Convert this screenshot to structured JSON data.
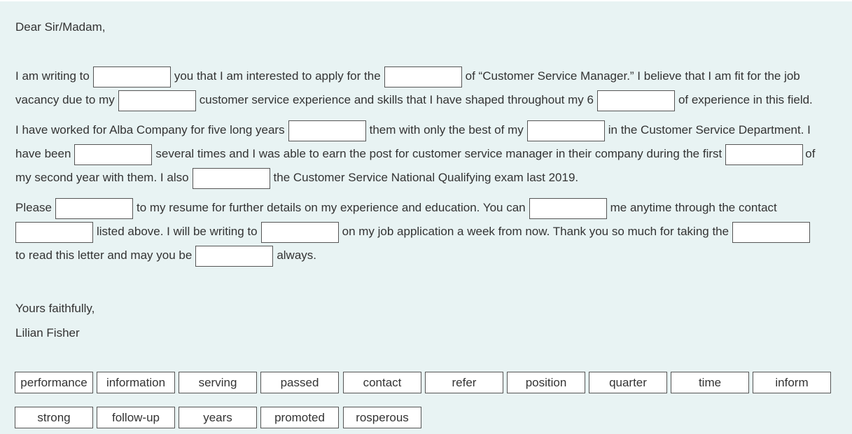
{
  "letter": {
    "greeting": "Dear Sir/Madam,",
    "p1": {
      "s1": "I am writing to",
      "s2": "you that I am interested to apply for the",
      "s3": "of “Customer Service Manager.” I believe that I am fit for the job",
      "s4": "vacancy due to my",
      "s5": "customer service experience and skills that I have shaped throughout my 6",
      "s6": "of experience in this field."
    },
    "p2": {
      "s1": "I have worked for Alba Company for five long years",
      "s2": "them with only the best of my",
      "s3": "in the Customer Service Department. I",
      "s4": "have been",
      "s5": "several times and I was able to earn the post for customer service manager in their company during the first",
      "s6": "of",
      "s7": "my second year with them. I also",
      "s8": "the Customer Service National Qualifying exam last 2019."
    },
    "p3": {
      "s1": "Please",
      "s2": "to my resume for further details on my experience and education. You can",
      "s3": "me anytime through the contact",
      "s4": "listed above. I will be writing to",
      "s5": "on my job application a week from now. Thank you so much for taking the",
      "s6": "to read this letter and may you be",
      "s7": "always."
    },
    "closing": "Yours faithfully,",
    "signature": "Lilian Fisher"
  },
  "word_bank": [
    "performance",
    "information",
    "serving",
    "passed",
    "contact",
    "refer",
    "position",
    "quarter",
    "time",
    "inform",
    "strong",
    "follow-up",
    "years",
    "promoted",
    "rosperous"
  ]
}
